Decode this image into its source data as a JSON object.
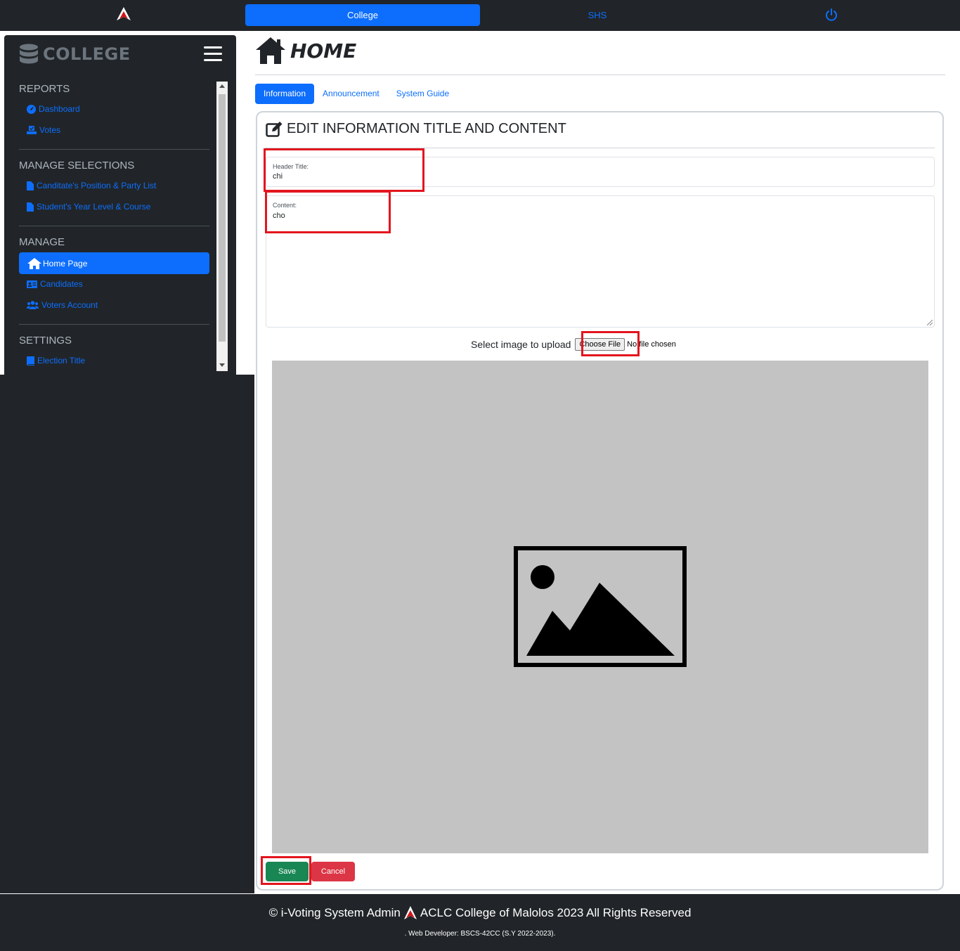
{
  "topnav": {
    "tab_college": "College",
    "tab_shs": "SHS",
    "logo_icon": "aclc-logo-icon",
    "power_icon": "power-icon"
  },
  "sidebar": {
    "brand": "COLLEGE",
    "sections": [
      {
        "title": "REPORTS",
        "items": [
          "Dashboard",
          "Votes"
        ]
      },
      {
        "title": "MANAGE SELECTIONS",
        "items": [
          "Canditate's Position & Party List",
          "Student's Year Level & Course"
        ]
      },
      {
        "title": "MANAGE",
        "items": [
          "Home Page",
          "Candidates",
          "Voters Account"
        ]
      },
      {
        "title": "SETTINGS",
        "items": [
          "Election Title"
        ]
      }
    ]
  },
  "main": {
    "page_title": "HOME",
    "tabs": [
      "Information",
      "Announcement",
      "System Guide"
    ],
    "active_tab": "Information",
    "card_title": "EDIT INFORMATION TITLE AND CONTENT",
    "header_title_label": "Header Title:",
    "header_title_value": "chi",
    "content_label": "Content:",
    "content_value": "cho",
    "upload_label": "Select image to upload",
    "choose_file": "Choose File",
    "no_file": "No file chosen",
    "save": "Save",
    "cancel": "Cancel"
  },
  "footer": {
    "line1_left": "© i-Voting System Admin",
    "line1_right": "ACLC College of Malolos 2023 All Rights Reserved",
    "line2": ". Web Developer: BSCS-42CC (S.Y 2022-2023)."
  },
  "colors": {
    "primary": "#0d6efd",
    "dark": "#212529",
    "success": "#198754",
    "danger": "#dc3545",
    "highlight": "#e3151e"
  }
}
